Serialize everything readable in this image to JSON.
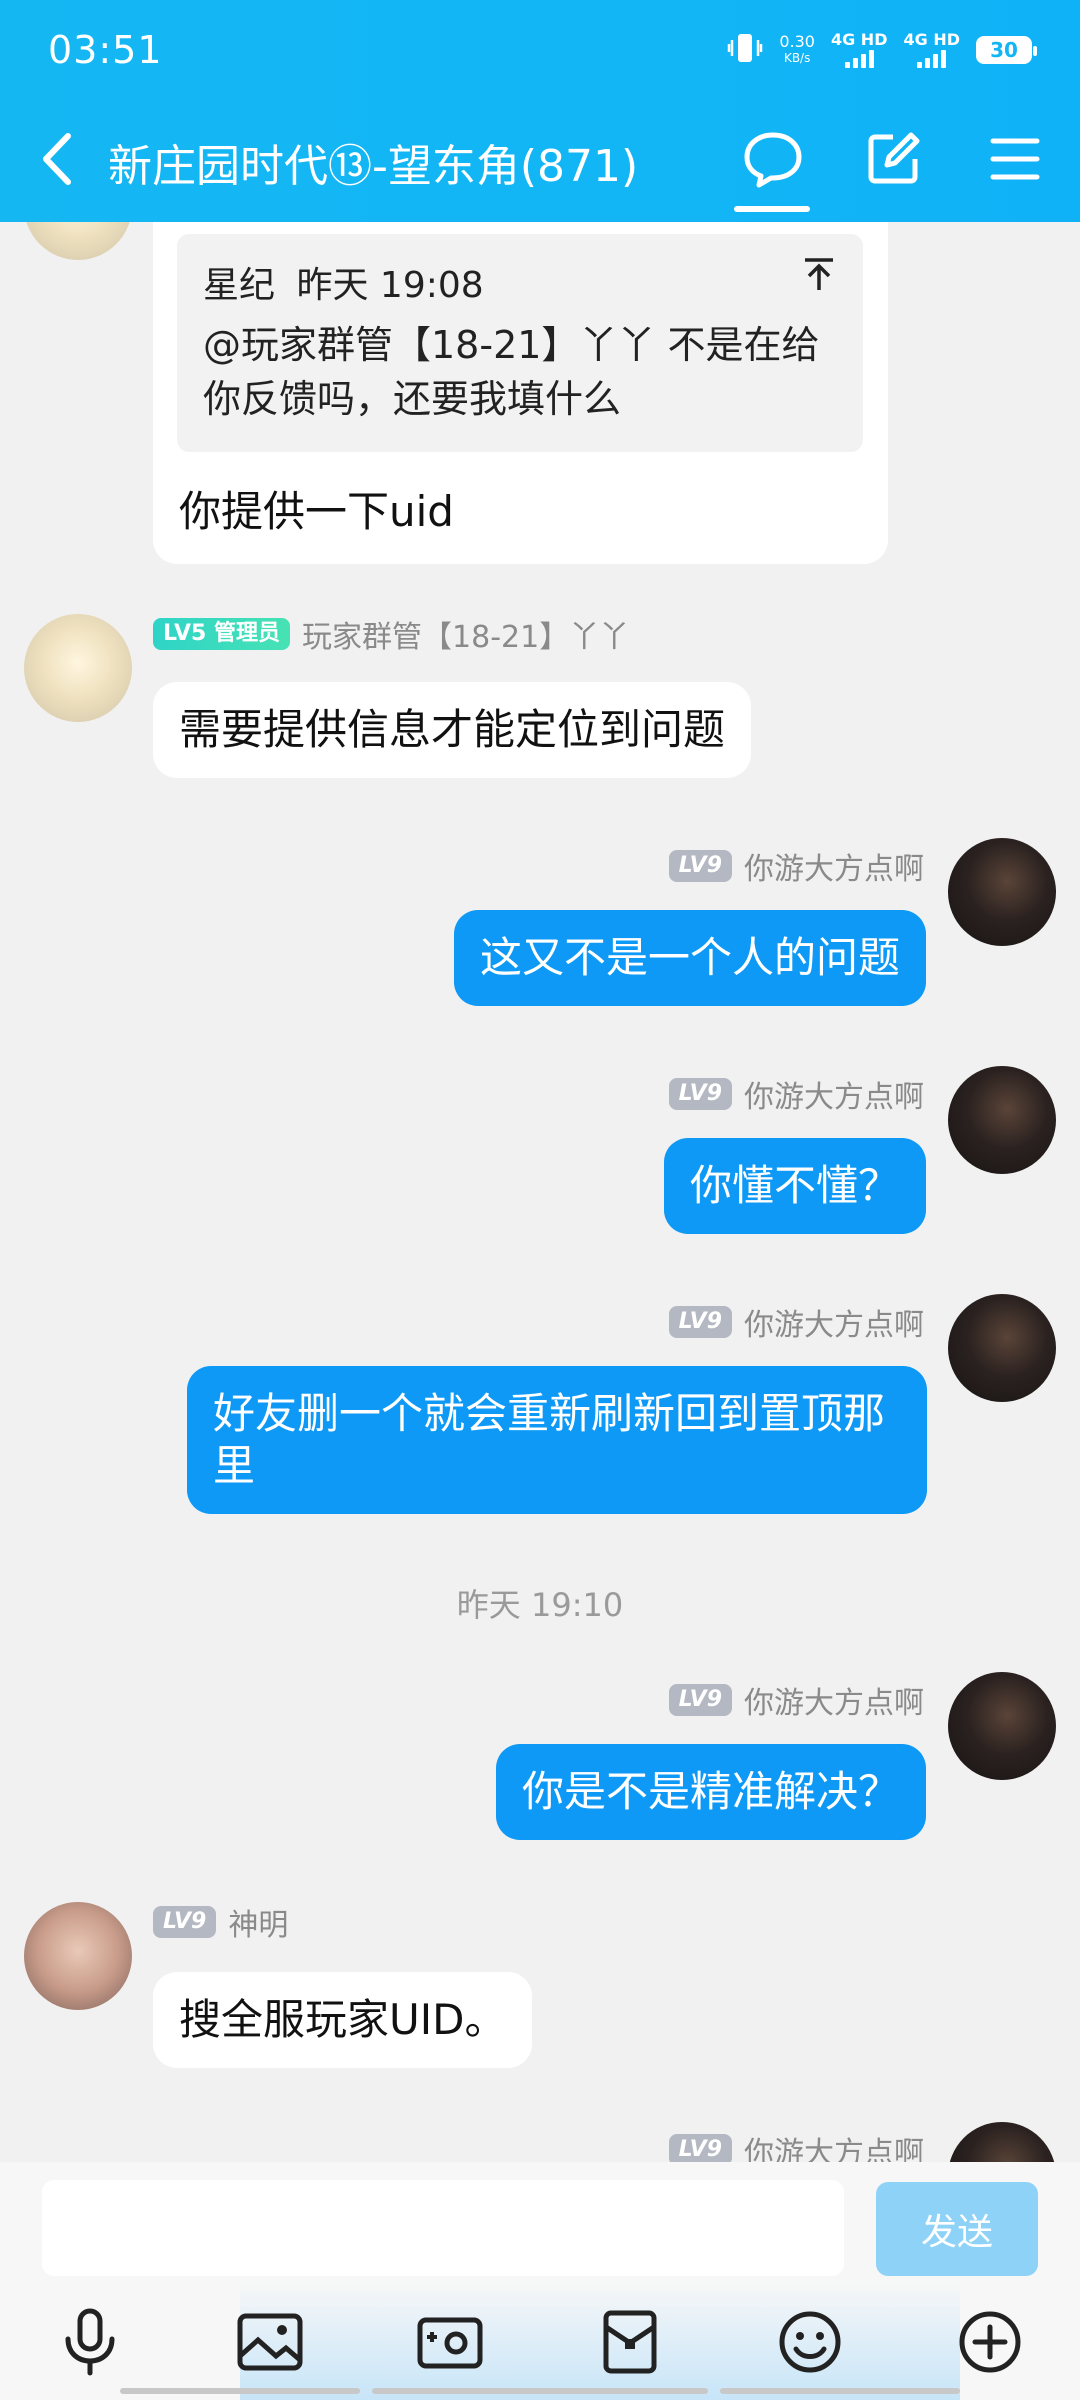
{
  "status_bar": {
    "time": "03:51",
    "net_speed_value": "0.30",
    "net_speed_unit": "KB/s",
    "sim1": "4G HD",
    "sim2": "4G HD",
    "battery": "30"
  },
  "header": {
    "title": "新庄园时代⑬-望东角(871)",
    "icons": [
      "back-icon",
      "chat-bubble-icon",
      "edit-icon",
      "menu-icon"
    ]
  },
  "quote_message": {
    "quote_author": "星纪",
    "quote_time": "昨天 19:08",
    "quote_text": "@玩家群管【18-21】丫丫 不是在给你反馈吗，还要我填什么",
    "reply_text": "你提供一下uid"
  },
  "messages": [
    {
      "side": "in",
      "level": "LV5",
      "role": "管理员",
      "name": "玩家群管【18-21】丫丫",
      "text": "需要提供信息才能定位到问题"
    },
    {
      "side": "out",
      "level": "LV9",
      "name": "你游大方点啊",
      "text": "这又不是一个人的问题"
    },
    {
      "side": "out",
      "level": "LV9",
      "name": "你游大方点啊",
      "text": "你懂不懂？"
    },
    {
      "side": "out",
      "level": "LV9",
      "name": "你游大方点啊",
      "text": "好友删一个就会重新刷新回到置顶那里"
    },
    {
      "side": "out",
      "level": "LV9",
      "name": "你游大方点啊",
      "text": "你是不是精准解决？"
    },
    {
      "side": "in",
      "level": "LV9",
      "name": "神明",
      "text": "搜全服玩家UID。"
    },
    {
      "side": "out",
      "level": "LV9",
      "name": "你游大方点啊",
      "text": ""
    }
  ],
  "timestamp": "昨天 19:10",
  "input": {
    "placeholder": "",
    "send_label": "发送"
  },
  "toolbar_icons": [
    "microphone-icon",
    "image-icon",
    "camera-icon",
    "red-packet-icon",
    "emoji-icon",
    "plus-icon"
  ],
  "colors": {
    "header": "#12b6f5",
    "outgoing_bubble": "#0d99f5",
    "send_button": "#8fd2f8"
  }
}
